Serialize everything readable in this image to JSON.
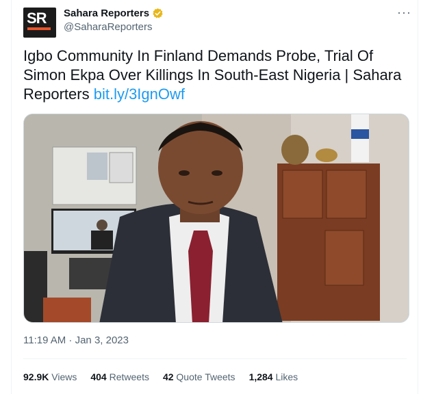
{
  "account": {
    "display_name": "Sahara Reporters",
    "handle": "@SaharaReporters",
    "avatar_text": "SR",
    "verified": true
  },
  "tweet": {
    "text": "Igbo Community In Finland Demands Probe, Trial Of Simon Ekpa Over Killings In South-East Nigeria | Sahara Reporters ",
    "link": "bit.ly/3IgnOwf",
    "timestamp": "11:19 AM · Jan 3, 2023"
  },
  "menu": {
    "more_icon": "···"
  },
  "stats": [
    {
      "count": "92.9K",
      "label": "Views"
    },
    {
      "count": "404",
      "label": "Retweets"
    },
    {
      "count": "42",
      "label": "Quote Tweets"
    },
    {
      "count": "1,284",
      "label": "Likes"
    }
  ],
  "colors": {
    "link": "#1d9bf0",
    "verified": "#e8b71a",
    "brand": "#e8542a"
  }
}
